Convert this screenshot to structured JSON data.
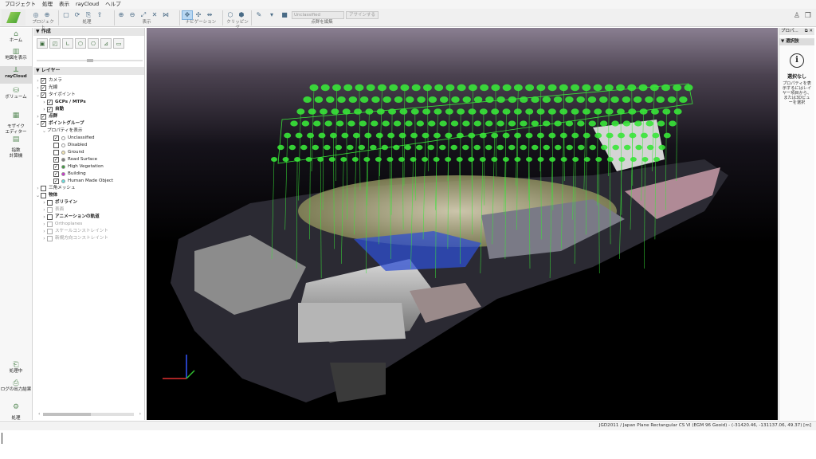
{
  "menu": [
    "プロジェクト",
    "処理",
    "表示",
    "rayCloud",
    "ヘルプ"
  ],
  "toolbar": {
    "groups": [
      {
        "label": "プロジェクト",
        "icons": [
          "open-project-icon",
          "add-images-icon"
        ]
      },
      {
        "label": "処理",
        "icons": [
          "process-icon",
          "reoptimize-icon",
          "rematch-icon",
          "export-icon",
          "report-icon"
        ]
      },
      {
        "label": "表示",
        "icons": [
          "zoom-in-icon",
          "zoom-out-icon",
          "fit-view-icon",
          "perspective-icon",
          "align-view-icon"
        ]
      },
      {
        "label": "ナビゲーション",
        "icons": [
          "navigation-trackball-icon",
          "navigation-fly-icon",
          "navigation-3d-icon"
        ]
      },
      {
        "label": "クリッピング",
        "icons": [
          "clipping-box-icon",
          "clipping-edit-icon"
        ]
      },
      {
        "label": "点群を編集",
        "icons": [
          "edit-brush-icon",
          "selection-mode-icon",
          "class-color-icon"
        ]
      }
    ],
    "class_combo": "Unclassified",
    "assign_button": "アサインする"
  },
  "nav": [
    {
      "label": "ホーム",
      "icon": "home-icon"
    },
    {
      "label": "地図を表示",
      "icon": "map-icon"
    },
    {
      "label": "rayCloud",
      "icon": "raycloud-icon",
      "active": true
    },
    {
      "label": "ボリューム",
      "icon": "volume-icon"
    },
    {
      "label": "モザイク\nエディター",
      "icon": "mosaic-icon"
    },
    {
      "label": "指数\n計算機",
      "icon": "index-calculator-icon"
    },
    {
      "label": "処理中",
      "icon": "processing-icon"
    },
    {
      "label": "ログの出力結果",
      "icon": "log-output-icon"
    },
    {
      "label": "処理\nオプション",
      "icon": "processing-options-icon"
    }
  ],
  "create_panel": {
    "title": "作成",
    "tools": [
      "new-point-icon",
      "new-polyline-icon",
      "new-surface-icon",
      "new-volume-icon",
      "new-camera-icon",
      "new-mesh-icon",
      "new-orthoplane-icon"
    ]
  },
  "layers_panel": {
    "title": "レイヤー",
    "tree": [
      {
        "indent": 0,
        "label": "カメラ",
        "checked": true,
        "bold": false
      },
      {
        "indent": 0,
        "label": "光線",
        "checked": true,
        "bold": false
      },
      {
        "indent": 0,
        "label": "タイポイント",
        "checked": true,
        "bold": false,
        "expanded": true
      },
      {
        "indent": 1,
        "label": "GCPs / MTPs",
        "checked": true,
        "bold": true
      },
      {
        "indent": 1,
        "label": "自動",
        "checked": true,
        "bold": true
      },
      {
        "indent": 0,
        "label": "点群",
        "checked": true,
        "bold": true
      },
      {
        "indent": 0,
        "label": "ポイントグループ",
        "checked": true,
        "bold": true,
        "expanded": true
      },
      {
        "indent": 1,
        "label": "プロパティを表示",
        "bold": false,
        "expanded": true,
        "nocheck": true
      },
      {
        "indent": 2,
        "label": "Unclassified",
        "checked": true,
        "dot": "#ffffff"
      },
      {
        "indent": 2,
        "label": "Disabled",
        "checked": false,
        "dot": "#ffffff"
      },
      {
        "indent": 2,
        "label": "Ground",
        "checked": false,
        "dot": "#f2e6b3"
      },
      {
        "indent": 2,
        "label": "Road Surface",
        "checked": true,
        "dot": "#808080"
      },
      {
        "indent": 2,
        "label": "High Vegetation",
        "checked": true,
        "dot": "#3d9a3d"
      },
      {
        "indent": 2,
        "label": "Building",
        "checked": true,
        "dot": "#cc33cc"
      },
      {
        "indent": 2,
        "label": "Human Made Object",
        "checked": true,
        "dot": "#66e0e0"
      },
      {
        "indent": 0,
        "label": "三角メッシュ",
        "checked": false,
        "bold": false
      },
      {
        "indent": 0,
        "label": "物体",
        "checked": false,
        "bold": true,
        "expanded": true
      },
      {
        "indent": 1,
        "label": "ポリライン",
        "checked": false,
        "bold": true
      },
      {
        "indent": 1,
        "label": "表面",
        "checked": false,
        "grey": true
      },
      {
        "indent": 1,
        "label": "アニメーションの軌道",
        "checked": false,
        "bold": true
      },
      {
        "indent": 1,
        "label": "Orthoplanes",
        "checked": false,
        "grey": true
      },
      {
        "indent": 1,
        "label": "スケールコンストレイント",
        "checked": false,
        "grey": true
      },
      {
        "indent": 1,
        "label": "新規方向コンストレイント",
        "checked": false,
        "grey": true
      }
    ]
  },
  "right_panel": {
    "title": "プロパ...",
    "title_icons": "⧉ ✕",
    "section": "選択肢",
    "no_selection": "選択なし",
    "hint": "プロパティを表示するにはレイヤー項目から、または3Dビューを選択"
  },
  "status": {
    "text": "JGD2011 / Japan Plane Rectangular CS VI (EGM 96 Geoid) - (-31420.46, -131137.06, 49.37) [m]"
  },
  "colors": {
    "accent": "#3f9f2f",
    "selection": "#b8d7f2",
    "camera_green": "#39e639"
  }
}
